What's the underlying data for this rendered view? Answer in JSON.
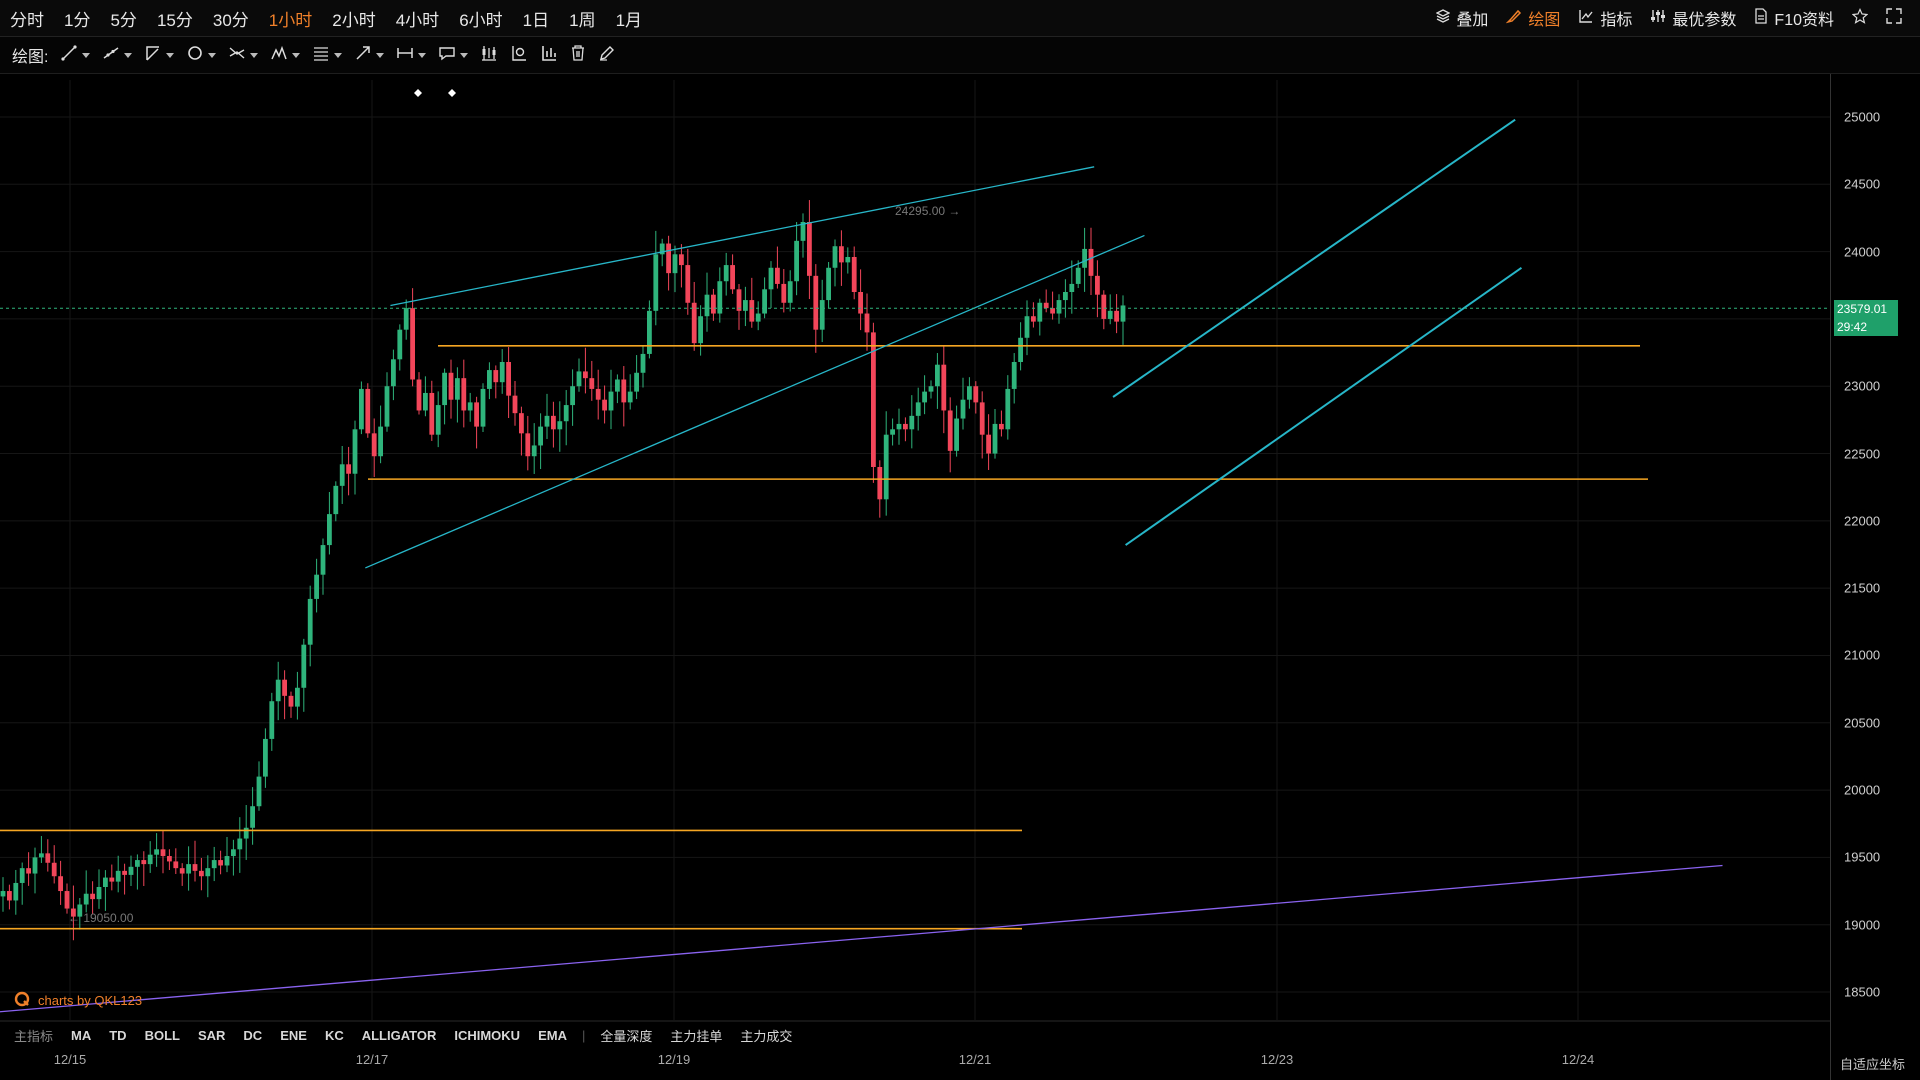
{
  "timeframes": [
    "分时",
    "1分",
    "5分",
    "15分",
    "30分",
    "1小时",
    "2小时",
    "4小时",
    "6小时",
    "1日",
    "1周",
    "1月"
  ],
  "active_timeframe": "1小时",
  "toolbar_right": {
    "overlay": "叠加",
    "draw": "绘图",
    "indicators": "指标",
    "best_params": "最优参数",
    "f10": "F10资料"
  },
  "draw_toolbar": {
    "label": "绘图:",
    "tools": [
      "line-tool-icon",
      "ray-tool-icon",
      "angle-tool-icon",
      "circle-tool-icon",
      "crossline-tool-icon",
      "pattern-tool-icon",
      "fib-tool-icon",
      "arrow-tool-icon",
      "measure-tool-icon",
      "note-tool-icon",
      "candle-tool-icon",
      "magnet-tool-icon",
      "bars-tool-icon",
      "trash-icon",
      "pen-icon"
    ]
  },
  "indicator_bar": {
    "main_label": "主指标",
    "items": [
      "MA",
      "TD",
      "BOLL",
      "SAR",
      "DC",
      "ENE",
      "KC",
      "ALLIGATOR",
      "ICHIMOKU",
      "EMA"
    ],
    "extra": [
      "全量深度",
      "主力挂单",
      "主力成交"
    ]
  },
  "brand": "charts by QKL123",
  "auto_axis": "自适应坐标",
  "current_price": "23579.01",
  "countdown": "29:42",
  "high_label": "24295.00 →",
  "low_label": "← 19050.00",
  "colors": {
    "up": "#2fb47c",
    "down": "#f2465a",
    "channel": "#27b6c8",
    "support": "#f5a623",
    "trend": "#8a63f0",
    "accent": "#f0802a"
  },
  "chart_data": {
    "type": "candlestick",
    "ylim": [
      18300,
      25300
    ],
    "yticks": [
      18500,
      19000,
      19500,
      20000,
      20500,
      21000,
      21500,
      22000,
      22500,
      23000,
      23500,
      24000,
      24500,
      25000
    ],
    "x_ticks": [
      "12/15",
      "12/17",
      "12/19",
      "12/21",
      "12/23",
      "12/24"
    ],
    "horizontal_levels": [
      23300,
      22310,
      19700,
      18970
    ],
    "trend_lines": [
      {
        "name": "channel-upper-1",
        "points": [
          [
            "12/17 03:00",
            23600
          ],
          [
            "12/21 19:00",
            24630
          ]
        ]
      },
      {
        "name": "channel-lower-1",
        "points": [
          [
            "12/16 23:00",
            21650
          ],
          [
            "12/22 03:00",
            24120
          ]
        ]
      },
      {
        "name": "channel-upper-2",
        "points": [
          [
            "12/21 22:00",
            22920
          ],
          [
            "12/24 14:00",
            24980
          ]
        ]
      },
      {
        "name": "channel-lower-2",
        "points": [
          [
            "12/22 00:00",
            21820
          ],
          [
            "12/24 15:00",
            23880
          ]
        ]
      },
      {
        "name": "long-trend",
        "points": [
          [
            "12/14 12:00",
            18350
          ],
          [
            "12/25 23:00",
            19440
          ]
        ]
      }
    ],
    "dashed_price_line": 23579.01,
    "closes_hourly": [
      19250,
      19180,
      19310,
      19420,
      19380,
      19500,
      19530,
      19460,
      19360,
      19250,
      19120,
      19060,
      19150,
      19230,
      19190,
      19280,
      19350,
      19320,
      19400,
      19370,
      19430,
      19480,
      19450,
      19520,
      19560,
      19510,
      19470,
      19420,
      19380,
      19450,
      19400,
      19360,
      19420,
      19480,
      19440,
      19510,
      19560,
      19640,
      19720,
      19880,
      20100,
      20380,
      20660,
      20820,
      20700,
      20620,
      20760,
      21080,
      21420,
      21600,
      21820,
      22050,
      22260,
      22420,
      22350,
      22680,
      22980,
      22650,
      22480,
      22700,
      23000,
      23200,
      23420,
      23580,
      23050,
      22820,
      22950,
      22640,
      22860,
      23100,
      22900,
      23060,
      22820,
      22880,
      22700,
      22980,
      23120,
      23030,
      23180,
      22930,
      22800,
      22650,
      22480,
      22560,
      22700,
      22780,
      22680,
      22740,
      22860,
      23000,
      23110,
      23060,
      22980,
      22900,
      22820,
      22960,
      23050,
      22880,
      22960,
      23100,
      23240,
      23560,
      23980,
      24060,
      23840,
      23980,
      23900,
      23620,
      23320,
      23520,
      23680,
      23540,
      23780,
      23900,
      23720,
      23560,
      23640,
      23480,
      23540,
      23720,
      23880,
      23760,
      23620,
      23780,
      24080,
      24220,
      23820,
      23420,
      23640,
      23880,
      24040,
      23920,
      23960,
      23700,
      23540,
      23400,
      22400,
      22160,
      22640,
      22680,
      22720,
      22680,
      22780,
      22880,
      22960,
      23000,
      23160,
      22820,
      22520,
      22760,
      22900,
      23000,
      22880,
      22640,
      22500,
      22720,
      22680,
      22980,
      23180,
      23360,
      23520,
      23480,
      23620,
      23580,
      23540,
      23640,
      23700,
      23760,
      23880,
      24020,
      23820,
      23680,
      23500,
      23560,
      23480,
      23600
    ]
  }
}
